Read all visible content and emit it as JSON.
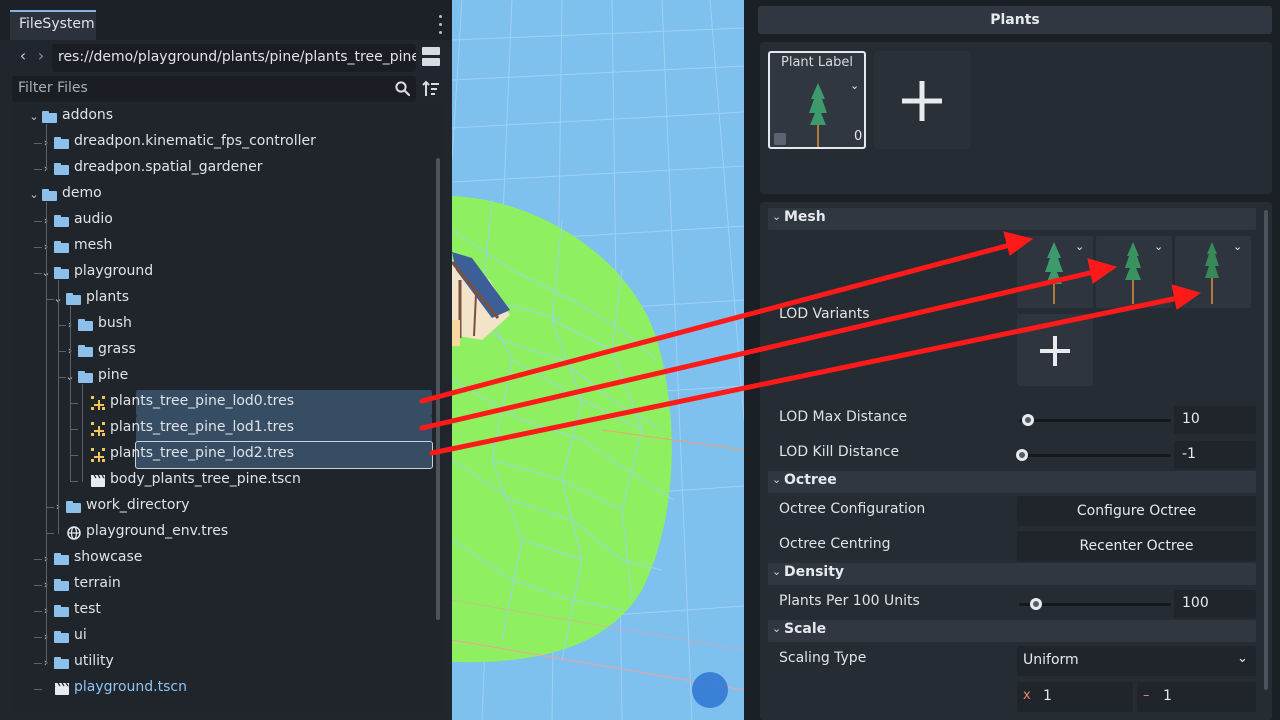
{
  "filesystem": {
    "tab_label": "FileSystem",
    "path": "res://demo/playground/plants/pine/plants_tree_pine_",
    "filter_placeholder": "Filter Files",
    "tree": [
      {
        "label": "addons",
        "kind": "folder",
        "depth": 0,
        "expanded": true
      },
      {
        "label": "dreadpon.kinematic_fps_controller",
        "kind": "folder",
        "depth": 1,
        "expanded": false
      },
      {
        "label": "dreadpon.spatial_gardener",
        "kind": "folder",
        "depth": 1,
        "expanded": false
      },
      {
        "label": "demo",
        "kind": "folder",
        "depth": 0,
        "expanded": true
      },
      {
        "label": "audio",
        "kind": "folder",
        "depth": 1,
        "expanded": false
      },
      {
        "label": "mesh",
        "kind": "folder",
        "depth": 1,
        "expanded": false
      },
      {
        "label": "playground",
        "kind": "folder",
        "depth": 1,
        "expanded": true
      },
      {
        "label": "plants",
        "kind": "folder",
        "depth": 2,
        "expanded": true
      },
      {
        "label": "bush",
        "kind": "folder",
        "depth": 3,
        "expanded": false
      },
      {
        "label": "grass",
        "kind": "folder",
        "depth": 3,
        "expanded": false
      },
      {
        "label": "pine",
        "kind": "folder",
        "depth": 3,
        "expanded": true
      },
      {
        "label": "plants_tree_pine_lod0.tres",
        "kind": "resource",
        "depth": 4,
        "selected": true
      },
      {
        "label": "plants_tree_pine_lod1.tres",
        "kind": "resource",
        "depth": 4,
        "selected": true
      },
      {
        "label": "plants_tree_pine_lod2.tres",
        "kind": "resource",
        "depth": 4,
        "selected": true,
        "active": true
      },
      {
        "label": "body_plants_tree_pine.tscn",
        "kind": "scene",
        "depth": 4
      },
      {
        "label": "work_directory",
        "kind": "folder",
        "depth": 2,
        "expanded": false
      },
      {
        "label": "playground_env.tres",
        "kind": "environment",
        "depth": 2
      },
      {
        "label": "showcase",
        "kind": "folder",
        "depth": 1,
        "expanded": false
      },
      {
        "label": "terrain",
        "kind": "folder",
        "depth": 1,
        "expanded": false
      },
      {
        "label": "test",
        "kind": "folder",
        "depth": 1,
        "expanded": false
      },
      {
        "label": "ui",
        "kind": "folder",
        "depth": 1,
        "expanded": false
      },
      {
        "label": "utility",
        "kind": "folder",
        "depth": 1,
        "expanded": false
      },
      {
        "label": "playground.tscn",
        "kind": "scene",
        "depth": 1,
        "open": true
      }
    ],
    "icons": {
      "back": "chevron-left-icon",
      "forward": "chevron-right-icon",
      "search": "search-icon",
      "sort": "sort-icon",
      "split": "split-mode-icon",
      "menu": "kebab-menu-icon"
    },
    "colors": {
      "folder": "#8cc0ea",
      "selection": "#374d63",
      "open_scene_text": "#8ec3f2"
    }
  },
  "inspector": {
    "title": "Plants",
    "plant_card": {
      "label": "Plant Label",
      "count": "0"
    },
    "sections": {
      "mesh": "Mesh",
      "octree": "Octree",
      "density": "Density",
      "scale": "Scale"
    },
    "properties": {
      "lod_variants": "LOD Variants",
      "lod_max_distance": {
        "label": "LOD Max Distance",
        "value": "10",
        "fraction": 0.04
      },
      "lod_kill_distance": {
        "label": "LOD Kill Distance",
        "value": "-1",
        "fraction": 0.0
      },
      "octree_configuration": {
        "label": "Octree Configuration",
        "button": "Configure Octree"
      },
      "octree_centring": {
        "label": "Octree Centring",
        "button": "Recenter Octree"
      },
      "plants_per_100": {
        "label": "Plants Per 100 Units",
        "value": "100",
        "fraction": 0.1
      },
      "scaling_type": {
        "label": "Scaling Type",
        "value": "Uniform"
      },
      "scale_range": {
        "x_label": "x",
        "x_value": "1",
        "link_label": "–",
        "y_value": "1"
      }
    },
    "lod_slot_count": 3
  },
  "annotation": {
    "arrow_color": "#ff1a1a",
    "arrow_count": 3
  }
}
